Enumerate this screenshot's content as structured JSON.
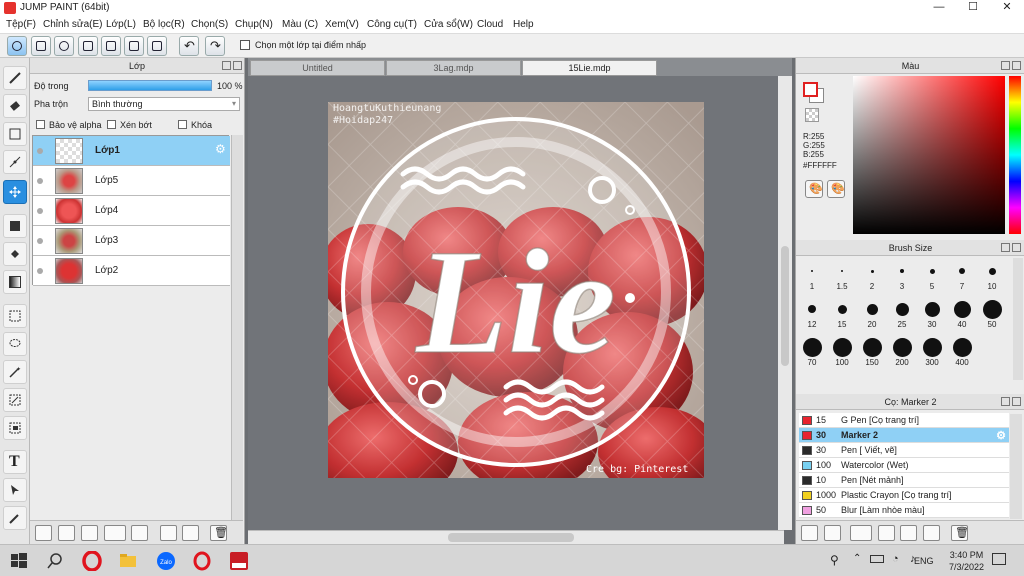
{
  "window": {
    "title": "JUMP PAINT (64bit)",
    "minimize": "—",
    "maximize": "☐",
    "close": "✕"
  },
  "menu": [
    "Tệp(F)",
    "Chỉnh sửa(E)",
    "Lớp(L)",
    "Bộ lọc(R)",
    "Chọn(S)",
    "Chụp(N)",
    "Màu (C)",
    "Xem(V)",
    "Công cụ(T)",
    "Cửa sổ(W)",
    "Cloud",
    "Help"
  ],
  "toolbar": {
    "checkbox_label": "Chọn một lớp tại điểm nhấp"
  },
  "layer_panel": {
    "title": "Lớp",
    "opacity_label": "Độ trong",
    "opacity_value": "100 %",
    "blend_label": "Pha trộn",
    "blend_value": "Bình thường",
    "options": [
      "Bảo vệ alpha",
      "Xén bớt",
      "Khóa"
    ],
    "layers": [
      {
        "name": "Lớp1",
        "selected": true
      },
      {
        "name": "Lớp5",
        "selected": false
      },
      {
        "name": "Lớp4",
        "selected": false
      },
      {
        "name": "Lớp3",
        "selected": false
      },
      {
        "name": "Lớp2",
        "selected": false
      }
    ]
  },
  "tabs": [
    {
      "label": "Untitled",
      "active": false
    },
    {
      "label": "3Lag.mdp",
      "active": false
    },
    {
      "label": "15Lie.mdp",
      "active": true
    }
  ],
  "artwork": {
    "watermark_line1": "HoangtuKuthieunang",
    "watermark_line2": "#Hoidap247",
    "main_text": "Lie",
    "credit": "Cre bg: Pinterest"
  },
  "color_panel": {
    "title": "Màu",
    "rgb": [
      "R:255",
      "G:255",
      "B:255"
    ],
    "hex": "#FFFFFF"
  },
  "brush_panel": {
    "title": "Brush Size",
    "sizes": [
      "1",
      "1.5",
      "2",
      "3",
      "5",
      "7",
      "10",
      "12",
      "15",
      "20",
      "25",
      "30",
      "40",
      "50",
      "70",
      "100",
      "150",
      "200",
      "300",
      "400"
    ]
  },
  "tool_panel": {
    "title": "Cọ: Marker 2",
    "tools": [
      {
        "size": "15",
        "name": "G Pen [Cọ trang trí]",
        "color": "#e8232e",
        "selected": false
      },
      {
        "size": "30",
        "name": "Marker 2",
        "color": "#e8232e",
        "selected": true
      },
      {
        "size": "30",
        "name": "Pen [ Viết, vẽ]",
        "color": "#2a2a2a",
        "selected": false
      },
      {
        "size": "100",
        "name": "Watercolor (Wet)",
        "color": "#78d0f0",
        "selected": false
      },
      {
        "size": "10",
        "name": "Pen [Nét mảnh]",
        "color": "#2a2a2a",
        "selected": false
      },
      {
        "size": "1000",
        "name": "Plastic Crayon [Cọ trang trí]",
        "color": "#f0d020",
        "selected": false
      },
      {
        "size": "50",
        "name": "Blur [Làm nhòe màu]",
        "color": "#f0a0e0",
        "selected": false
      }
    ]
  },
  "taskbar": {
    "lang": "ENG",
    "time": "3:40 PM",
    "date": "7/3/2022"
  }
}
